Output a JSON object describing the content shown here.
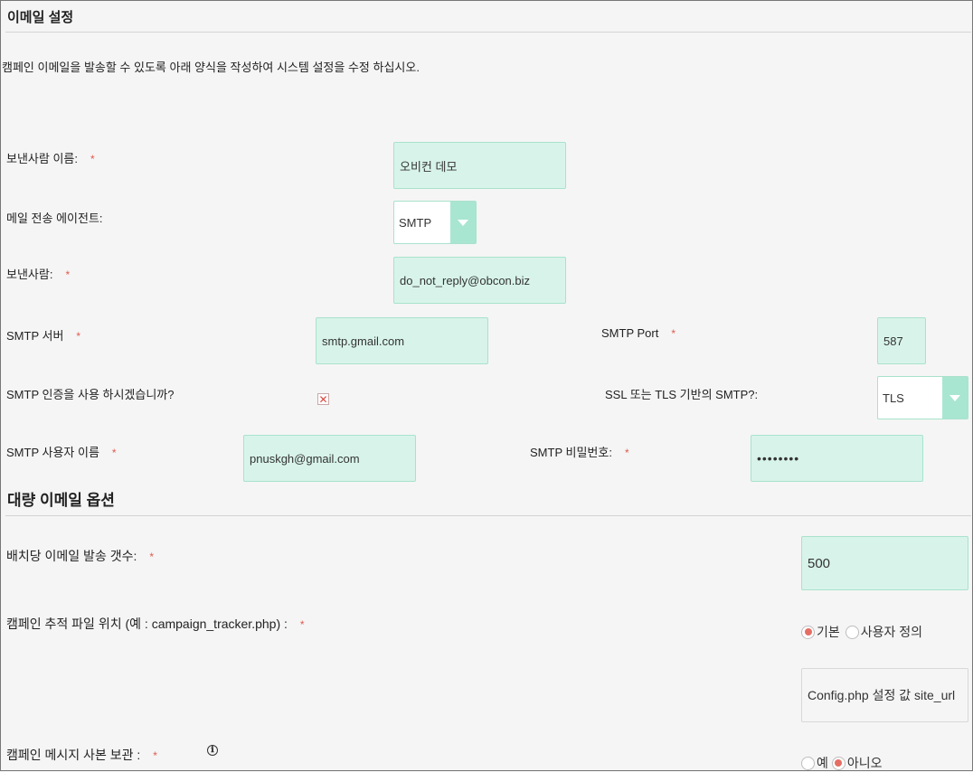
{
  "section_title": "이메일 설정",
  "description": "캠페인 이메일을 발송할 수 있도록 아래 양식을 작성하여 시스템 설정을 수정 하십시오.",
  "required_mark": "*",
  "fields": {
    "from_name": {
      "label": "보낸사람 이름:",
      "value": "오비컨 데모"
    },
    "mail_agent": {
      "label": "메일 전송 에이전트:",
      "value": "SMTP"
    },
    "from_address": {
      "label": "보낸사람:",
      "value": "do_not_reply@obcon.biz"
    },
    "smtp_server": {
      "label": "SMTP 서버",
      "value": "smtp.gmail.com"
    },
    "smtp_port": {
      "label": "SMTP Port",
      "value": "587"
    },
    "smtp_auth": {
      "label": "SMTP 인증을 사용 하시겠습니까?",
      "checked": true,
      "mark": "✕"
    },
    "ssl_tls": {
      "label": "SSL 또는 TLS 기반의 SMTP?:",
      "value": "TLS"
    },
    "smtp_user": {
      "label": "SMTP 사용자 이름",
      "value": "pnuskgh@gmail.com"
    },
    "smtp_password": {
      "label": "SMTP 비밀번호:",
      "value": "••••••••"
    }
  },
  "bulk_section_title": "대량 이메일 옵션",
  "bulk": {
    "batch_count": {
      "label": "배치당 이메일 발송 갯수:",
      "value": "500"
    },
    "tracker_location": {
      "label": "캠페인 추적 파일 위치 (예 : campaign_tracker.php) :",
      "options": [
        "기본",
        "사용자 정의"
      ],
      "selected": "기본",
      "info_text": "Config.php 설정 값 site_url"
    },
    "keep_copy": {
      "label": "캠페인 메시지 사본 보관 :",
      "info_icon": "ℹ",
      "options": [
        "예",
        "아니오"
      ],
      "selected": "아니오"
    }
  },
  "colors": {
    "field_bg": "#d8f4ea",
    "field_border": "#a9e2cc",
    "select_arrow": "#a8e6d2",
    "required": "#e05a4e"
  }
}
